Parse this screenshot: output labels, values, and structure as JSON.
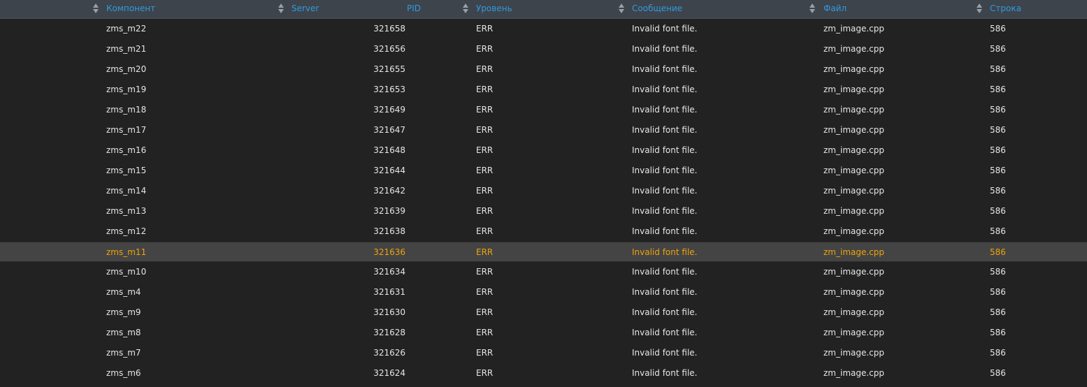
{
  "colors": {
    "background": "#222222",
    "header_background": "#3e444c",
    "header_text": "#2f9bde",
    "row_text": "#e6e6e6",
    "highlight_background": "#444444",
    "highlight_text": "#f0a30a"
  },
  "icons": {
    "sort": "sort-up-down-icon"
  },
  "table": {
    "columns": [
      "Компонент",
      "Server",
      "PID",
      "Уровень",
      "Сообщение",
      "Файл",
      "Строка"
    ],
    "highlighted_row": "zms_m11",
    "rows": [
      {
        "component": "zms_m22",
        "server": "",
        "pid": "321658",
        "level": "ERR",
        "message": "Invalid font file.",
        "file": "zm_image.cpp",
        "line": "586"
      },
      {
        "component": "zms_m21",
        "server": "",
        "pid": "321656",
        "level": "ERR",
        "message": "Invalid font file.",
        "file": "zm_image.cpp",
        "line": "586"
      },
      {
        "component": "zms_m20",
        "server": "",
        "pid": "321655",
        "level": "ERR",
        "message": "Invalid font file.",
        "file": "zm_image.cpp",
        "line": "586"
      },
      {
        "component": "zms_m19",
        "server": "",
        "pid": "321653",
        "level": "ERR",
        "message": "Invalid font file.",
        "file": "zm_image.cpp",
        "line": "586"
      },
      {
        "component": "zms_m18",
        "server": "",
        "pid": "321649",
        "level": "ERR",
        "message": "Invalid font file.",
        "file": "zm_image.cpp",
        "line": "586"
      },
      {
        "component": "zms_m17",
        "server": "",
        "pid": "321647",
        "level": "ERR",
        "message": "Invalid font file.",
        "file": "zm_image.cpp",
        "line": "586"
      },
      {
        "component": "zms_m16",
        "server": "",
        "pid": "321648",
        "level": "ERR",
        "message": "Invalid font file.",
        "file": "zm_image.cpp",
        "line": "586"
      },
      {
        "component": "zms_m15",
        "server": "",
        "pid": "321644",
        "level": "ERR",
        "message": "Invalid font file.",
        "file": "zm_image.cpp",
        "line": "586"
      },
      {
        "component": "zms_m14",
        "server": "",
        "pid": "321642",
        "level": "ERR",
        "message": "Invalid font file.",
        "file": "zm_image.cpp",
        "line": "586"
      },
      {
        "component": "zms_m13",
        "server": "",
        "pid": "321639",
        "level": "ERR",
        "message": "Invalid font file.",
        "file": "zm_image.cpp",
        "line": "586"
      },
      {
        "component": "zms_m12",
        "server": "",
        "pid": "321638",
        "level": "ERR",
        "message": "Invalid font file.",
        "file": "zm_image.cpp",
        "line": "586"
      },
      {
        "component": "zms_m11",
        "server": "",
        "pid": "321636",
        "level": "ERR",
        "message": "Invalid font file.",
        "file": "zm_image.cpp",
        "line": "586"
      },
      {
        "component": "zms_m10",
        "server": "",
        "pid": "321634",
        "level": "ERR",
        "message": "Invalid font file.",
        "file": "zm_image.cpp",
        "line": "586"
      },
      {
        "component": "zms_m4",
        "server": "",
        "pid": "321631",
        "level": "ERR",
        "message": "Invalid font file.",
        "file": "zm_image.cpp",
        "line": "586"
      },
      {
        "component": "zms_m9",
        "server": "",
        "pid": "321630",
        "level": "ERR",
        "message": "Invalid font file.",
        "file": "zm_image.cpp",
        "line": "586"
      },
      {
        "component": "zms_m8",
        "server": "",
        "pid": "321628",
        "level": "ERR",
        "message": "Invalid font file.",
        "file": "zm_image.cpp",
        "line": "586"
      },
      {
        "component": "zms_m7",
        "server": "",
        "pid": "321626",
        "level": "ERR",
        "message": "Invalid font file.",
        "file": "zm_image.cpp",
        "line": "586"
      },
      {
        "component": "zms_m6",
        "server": "",
        "pid": "321624",
        "level": "ERR",
        "message": "Invalid font file.",
        "file": "zm_image.cpp",
        "line": "586"
      }
    ]
  }
}
